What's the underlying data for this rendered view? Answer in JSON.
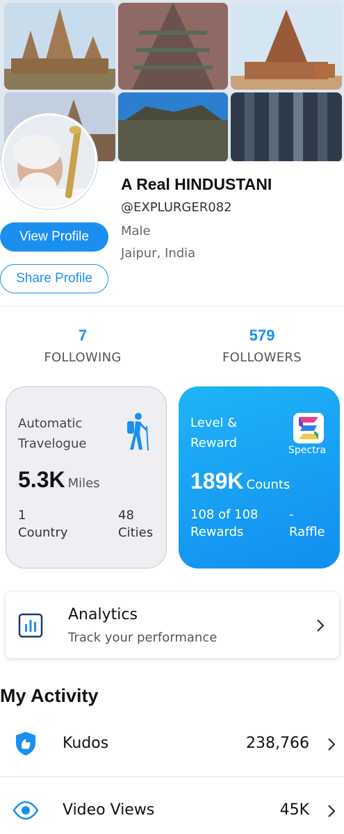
{
  "profile": {
    "name": "A Real HINDUSTANI",
    "handle": "@EXPLURGER082",
    "gender": "Male",
    "location": "Jaipur, India"
  },
  "buttons": {
    "view_profile": "View Profile",
    "share_profile": "Share Profile"
  },
  "stats": {
    "following_count": "7",
    "following_label": "FOLLOWING",
    "followers_count": "579",
    "followers_label": "FOLLOWERS"
  },
  "travelogue": {
    "title": "Automatic Travelogue",
    "value": "5.3K",
    "unit": "Miles",
    "country_count": "1",
    "country_label": "Country",
    "cities_count": "48",
    "cities_label": "Cities",
    "icon": "hiker-icon"
  },
  "reward": {
    "title": "Level & Reward",
    "value": "189K",
    "unit": "Counts",
    "rewards_line1": "108 of 108",
    "rewards_line2": "Rewards",
    "raffle_line1": "-",
    "raffle_line2": "Raffle",
    "brand": "Spectra",
    "icon": "spectra-logo"
  },
  "analytics": {
    "title": "Analytics",
    "subtitle": "Track your performance",
    "icon": "bar-chart-icon"
  },
  "activity": {
    "title": "My Activity",
    "items": [
      {
        "label": "Kudos",
        "value": "238,766",
        "icon": "kudos-shield-icon"
      },
      {
        "label": "Video Views",
        "value": "45K",
        "icon": "eye-icon"
      }
    ]
  },
  "colors": {
    "accent": "#1a8ff0",
    "reward_card": "#14a0f4",
    "travel_card": "#eeeef3"
  }
}
